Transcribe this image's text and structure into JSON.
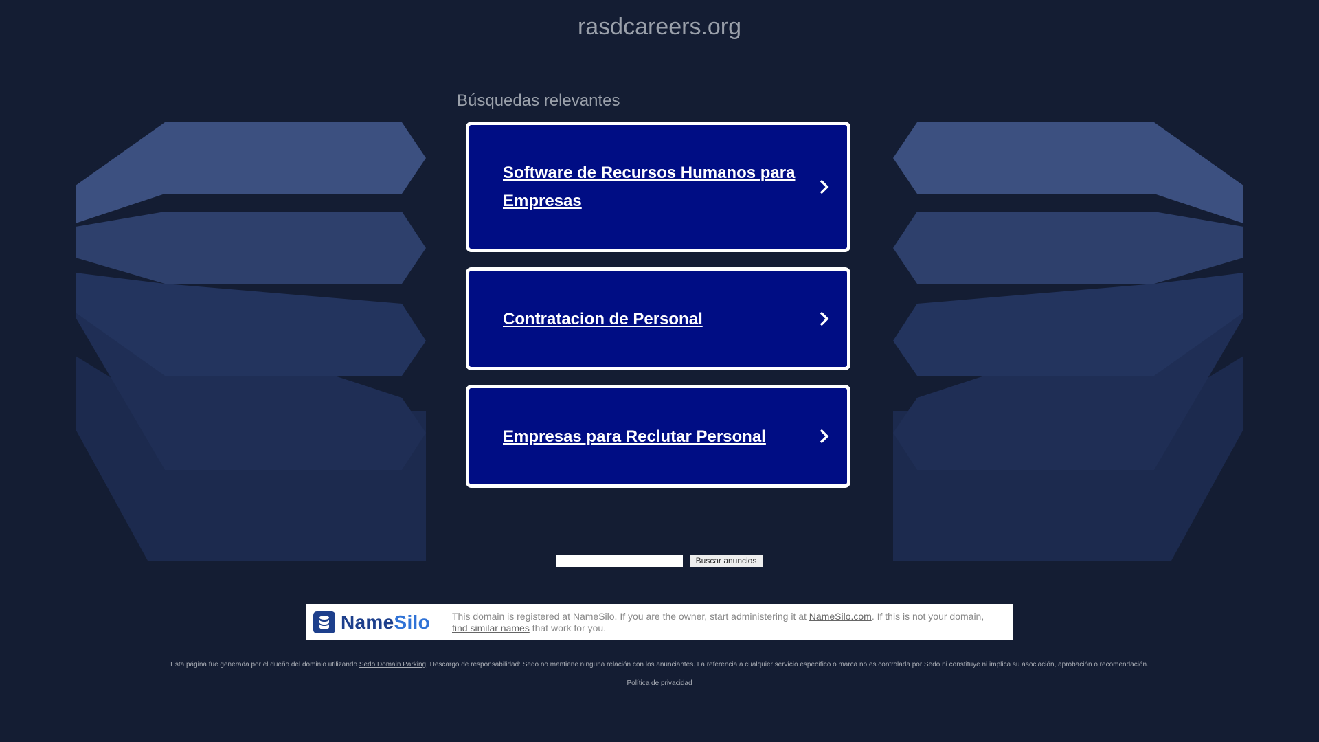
{
  "page": {
    "domain": "rasdcareers.org",
    "searches_heading": "Búsquedas relevantes"
  },
  "related_searches": [
    {
      "label": "Software de Recursos Humanos para Empresas"
    },
    {
      "label": "Contratacion de Personal"
    },
    {
      "label": "Empresas para Reclutar Personal"
    }
  ],
  "search": {
    "input_value": "",
    "button_label": "Buscar anuncios"
  },
  "registrar_banner": {
    "logo_name": "Name",
    "logo_silo": "Silo",
    "logo_icon": "database-icon",
    "text_before_link": "This domain is registered at NameSilo. If you are the owner, start administering it at ",
    "link_registrar": "NameSilo.com",
    "text_middle": ". If this is not your domain, ",
    "link_similar": "find similar names",
    "text_after": " that work for you."
  },
  "footer": {
    "disclaimer_before": "Esta página fue generada por el dueño del dominio utilizando ",
    "disclaimer_link": "Sedo Domain Parking",
    "disclaimer_after": ". Descargo de responsabilidad: Sedo no mantiene ninguna relación con los anunciantes. La referencia a cualquier servicio específico o marca no es controlada por Sedo ni constituye ni implica su asociación, aprobación o recomendación.",
    "privacy_link": "Política de privacidad"
  },
  "colors": {
    "background": "#141d33",
    "card": "#000d84",
    "card_border": "#ffffff"
  }
}
